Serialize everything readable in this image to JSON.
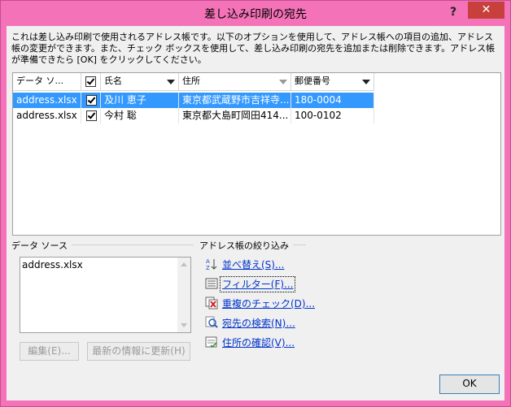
{
  "window": {
    "title": "差し込み印刷の宛先",
    "help_glyph": "?",
    "close_glyph": "✕"
  },
  "description": "これは差し込み印刷で使用されるアドレス帳です。以下のオプションを使用して、アドレス帳への項目の追加、アドレス帳の変更ができます。また、チェック ボックスを使用して、差し込み印刷の宛先を追加または削除できます。アドレス帳が準備できたら [OK] をクリックしてください。",
  "table": {
    "columns": [
      "データ ソ...",
      "",
      "氏名",
      "住所",
      "郵便番号"
    ],
    "rows": [
      {
        "source": "address.xlsx",
        "name": "及川 恵子",
        "address": "東京都武蔵野市吉祥寺...",
        "zip": "180-0004",
        "selected": true
      },
      {
        "source": "address.xlsx",
        "name": "今村 聡",
        "address": "東京都大島町岡田414...",
        "zip": "100-0102",
        "selected": false
      }
    ]
  },
  "datasource": {
    "group_label": "データ ソース",
    "items": [
      "address.xlsx"
    ],
    "edit_label": "編集(E)...",
    "refresh_label": "最新の情報に更新(H)"
  },
  "refine": {
    "group_label": "アドレス帳の絞り込み",
    "links": [
      "並べ替え(S)...",
      "フィルター(F)...",
      "重複のチェック(D)...",
      "宛先の検索(N)...",
      "住所の確認(V)..."
    ]
  },
  "ok_label": "OK",
  "colors": {
    "frame": "#f472b8",
    "close_button": "#c7403c",
    "selection": "#3399ff",
    "link": "#0033cc"
  }
}
